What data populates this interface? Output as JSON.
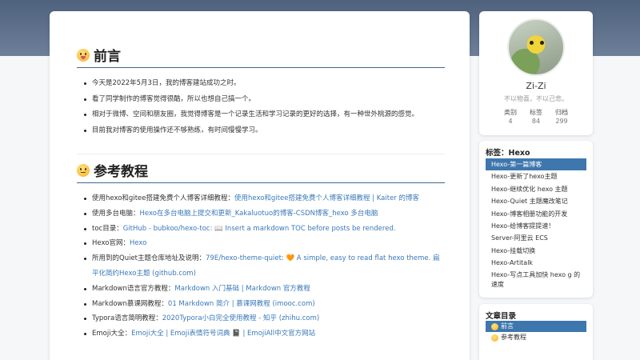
{
  "sections": [
    {
      "heading": "前言",
      "items": [
        "今天是2022年5月3日，我的博客建站成功之时。",
        "看了同学制作的博客觉得很酷，所以也想自己搞一个。",
        "相对于微博、空间和朋友圈，我觉得博客是一个记录生活和学习记录的更好的选择，有一种世外桃源的感觉。",
        "目前我对博客的使用操作还不够熟练，有时间慢慢学习。"
      ]
    },
    {
      "heading": "参考教程",
      "items": [
        {
          "text": "使用hexo和gitee搭建免费个人博客详细教程：",
          "link": "使用hexo和gitee搭建免费个人博客详细教程 | Kaiter 的博客"
        },
        {
          "text": "使用多台电脑：",
          "link": "Hexo在多台电脑上提交和更新_Kakaluotuo的博客-CSDN博客_hexo 多台电脑"
        },
        {
          "text": "toc目录：",
          "link": "GitHub - bubkoo/hexo-toc: 📖 Insert a markdown TOC before posts be rendered."
        },
        {
          "text": "Hexo官网：",
          "link": "Hexo"
        },
        {
          "text": "所用到的Quiet主题仓库地址及说明：",
          "link": "79E/hexo-theme-quiet: 🧡 A simple, easy to read flat hexo theme. 扁平化简约Hexo主题 (github.com)"
        },
        {
          "text": "Markdown语言官方教程：",
          "link": "Markdown 入门基础 | Markdown 官方教程"
        },
        {
          "text": "Markdown慕课网教程：",
          "link": "01 Markdown 简介 | 慕课网教程 (imooc.com)"
        },
        {
          "text": "Typora语言简明教程：",
          "link": "2020Typora小白完全使用教程 - 知乎 (zhihu.com)"
        },
        {
          "text": "Emoji大全：",
          "link": "Emoji大全 | Emoji表情符号词典 📓 | EmojiAll中文官方网站"
        }
      ]
    }
  ],
  "profile": {
    "name": "Zi-Zi",
    "motto": "不以物喜，不以己悲。",
    "stats": [
      {
        "label": "类别",
        "value": "4"
      },
      {
        "label": "标签",
        "value": "84"
      },
      {
        "label": "归档",
        "value": "299"
      }
    ]
  },
  "tags": {
    "title": "标签：Hexo",
    "items": [
      "Hexo-第一篇博客",
      "Hexo-更新了hexo主题",
      "Hexo-继续优化 hexo 主题",
      "Hexo-Quiet 主题魔改笔记",
      "Hexo-博客相册功能的开发",
      "Hexo-给博客提提速！",
      "Server-阿里云 ECS",
      "Hexo-挂载切换",
      "Hexo-Artitalk",
      "Hexo-写点工具加快 hexo g 的速度"
    ],
    "active_index": 0
  },
  "toc": {
    "title": "文章目录",
    "items": [
      "前言",
      "参考教程"
    ],
    "active_index": 0
  },
  "colors": {
    "header_band": "#5b6d88",
    "accent": "#3e77ad",
    "link": "#3a79b8"
  }
}
